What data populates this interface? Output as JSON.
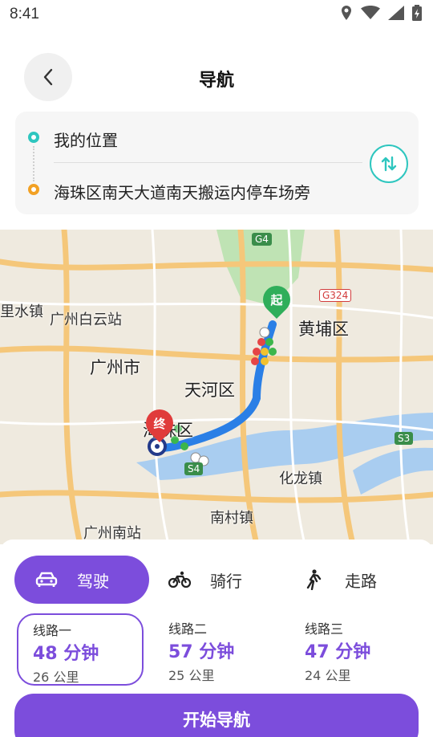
{
  "status_bar": {
    "time": "8:41"
  },
  "header": {
    "title": "导航"
  },
  "route": {
    "start": "我的位置",
    "end": "海珠区南天大道南天搬运内停车场旁"
  },
  "map": {
    "labels": [
      "黄埔区",
      "广州市",
      "天河区",
      "化龙镇",
      "南村镇",
      "广州南站",
      "广州白云站",
      "里水镇",
      "海珠区"
    ],
    "road_badges": [
      "G4",
      "S3",
      "G324",
      "S4"
    ],
    "start_marker": "起",
    "end_marker": "终"
  },
  "modes": [
    {
      "label": "驾驶",
      "active": true
    },
    {
      "label": "骑行",
      "active": false
    },
    {
      "label": "走路",
      "active": false
    }
  ],
  "routes": [
    {
      "name": "线路一",
      "time": "48 分钟",
      "distance": "26 公里",
      "selected": true
    },
    {
      "name": "线路二",
      "time": "57 分钟",
      "distance": "25 公里",
      "selected": false
    },
    {
      "name": "线路三",
      "time": "47 分钟",
      "distance": "24 公里",
      "selected": false
    }
  ],
  "actions": {
    "start_navigation": "开始导航"
  },
  "colors": {
    "accent": "#7c4ddc",
    "teal": "#2ec6bf",
    "orange": "#f2a124"
  }
}
